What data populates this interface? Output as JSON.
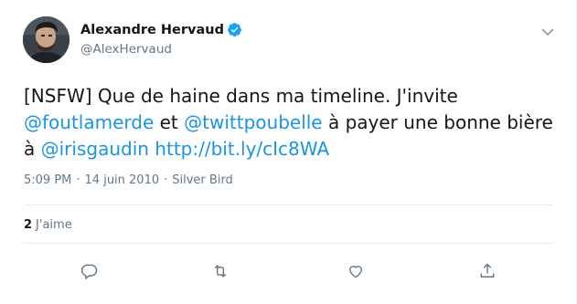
{
  "author": {
    "display_name": "Alexandre Hervaud",
    "handle": "@AlexHervaud",
    "verified_icon": "verified-badge-icon"
  },
  "tweet": {
    "segments": [
      {
        "type": "text",
        "value": "[NSFW] Que de haine dans ma timeline. J'invite "
      },
      {
        "type": "mention",
        "value": "@foutlamerde"
      },
      {
        "type": "text",
        "value": " et "
      },
      {
        "type": "mention",
        "value": "@twittpoubelle"
      },
      {
        "type": "text",
        "value": " à payer une bonne bière à "
      },
      {
        "type": "mention",
        "value": "@irisgaudin"
      },
      {
        "type": "text",
        "value": " "
      },
      {
        "type": "url",
        "value": "http://bit.ly/cIc8WA"
      }
    ]
  },
  "meta": {
    "time": "5:09 PM",
    "separator": "·",
    "date": "14 juin 2010",
    "source": "Silver Bird"
  },
  "stats": {
    "likes_count": "2",
    "likes_label": "J'aime"
  },
  "actions": {
    "reply_icon": "reply-icon",
    "retweet_icon": "retweet-icon",
    "like_icon": "heart-icon",
    "share_icon": "share-icon"
  },
  "colors": {
    "link": "#1b95e0",
    "verified": "#1da1f2",
    "muted": "#657786",
    "text": "#14171a",
    "divider": "#e6ecf0"
  }
}
